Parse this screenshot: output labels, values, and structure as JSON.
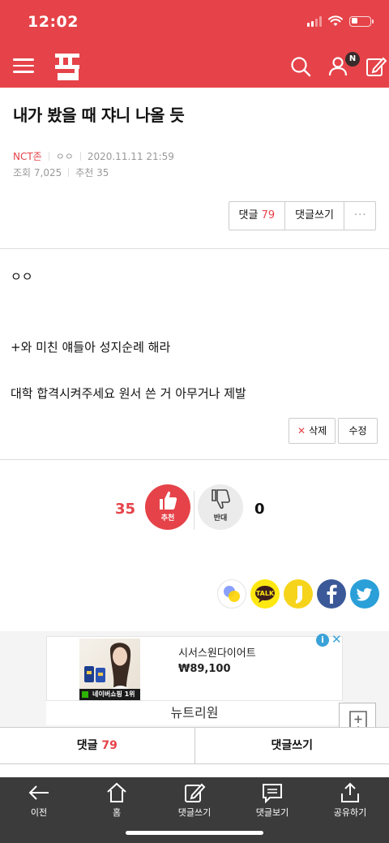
{
  "status_bar": {
    "time": "12:02"
  },
  "header": {
    "notification_badge": "N",
    "brand_color": "#e54349"
  },
  "post": {
    "title": "내가 봤을 때 쟈니 나올 듯",
    "category": "NCT존",
    "author": "ㅇㅇ",
    "date": "2020.11.11 21:59",
    "views": "조회 7,025",
    "recommends": "추천 35"
  },
  "top_actions": {
    "comments_label": "댓글",
    "comments_count": "79",
    "write_comment": "댓글쓰기",
    "more": "···"
  },
  "content": {
    "line1": "ㅇㅇ",
    "line2": "+와 미친 얘들아 성지순례 해라",
    "line3": "대학 합격시켜주세요 원서 쓴 거 아무거나 제발"
  },
  "post_actions": {
    "delete": "삭제",
    "delete_mark": "✕",
    "edit": "수정"
  },
  "votes": {
    "up_count": "35",
    "up_label": "추천",
    "down_label": "반대",
    "down_count": "0"
  },
  "share": {
    "icons": [
      "kakao-story-icon",
      "kakao-talk-icon",
      "kakao-page-icon",
      "facebook-icon",
      "twitter-icon"
    ],
    "talk_label": "TALK"
  },
  "ad": {
    "product_name": "시서스원다이어트",
    "price": "₩89,100",
    "brand": "뉴트리원",
    "badge_text": "네이버쇼핑 1위",
    "info_mark": "i",
    "close_mark": "✕"
  },
  "bottom_tabs": {
    "comments_label": "댓글",
    "comments_count": "79",
    "write_comment": "댓글쓰기"
  },
  "toolbar": {
    "back": "이전",
    "home": "홈",
    "write": "댓글쓰기",
    "view": "댓글보기",
    "share": "공유하기"
  }
}
